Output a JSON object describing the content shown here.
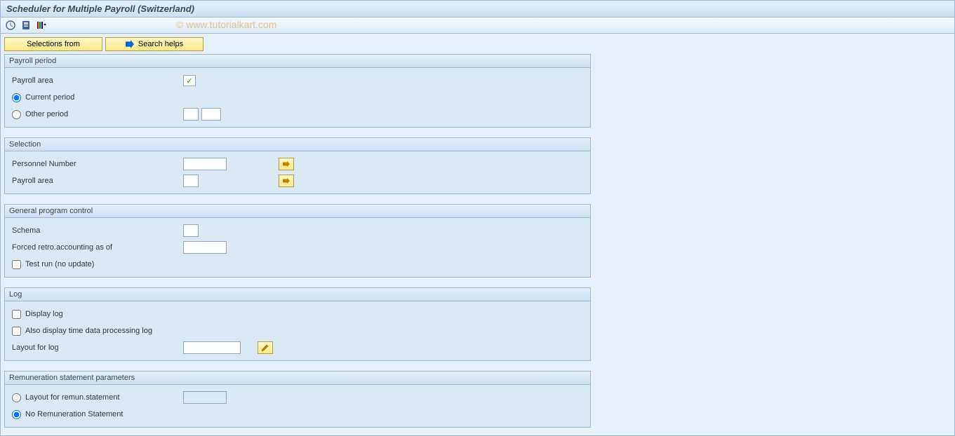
{
  "title": "Scheduler for Multiple Payroll (Switzerland)",
  "watermark": "© www.tutorialkart.com",
  "buttons": {
    "selections_from": "Selections from",
    "search_helps": "Search helps"
  },
  "panels": {
    "payroll_period": {
      "header": "Payroll period",
      "payroll_area_label": "Payroll area",
      "current_period_label": "Current period",
      "other_period_label": "Other period"
    },
    "selection": {
      "header": "Selection",
      "personnel_number_label": "Personnel Number",
      "payroll_area_label": "Payroll area"
    },
    "general_program_control": {
      "header": "General program control",
      "schema_label": "Schema",
      "forced_retro_label": "Forced retro.accounting as of",
      "test_run_label": "Test run (no update)"
    },
    "log": {
      "header": "Log",
      "display_log_label": "Display log",
      "also_display_label": "Also display time data processing log",
      "layout_label": "Layout for log"
    },
    "remuneration": {
      "header": "Remuneration statement parameters",
      "layout_remun_label": "Layout for remun.statement",
      "no_remun_label": "No Remuneration Statement"
    }
  },
  "values": {
    "payroll_period_selected": "current",
    "remuneration_selected": "no_statement"
  }
}
